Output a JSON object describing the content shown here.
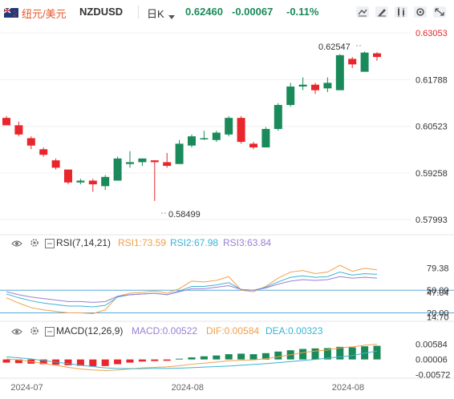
{
  "header": {
    "pair_name": "纽元/美元",
    "symbol": "NZDUSD",
    "timeframe": "日K",
    "price": "0.62460",
    "change": "-0.00067",
    "change_pct": "-0.11%"
  },
  "colors": {
    "up": "#1a8a5a",
    "down": "#e8262b",
    "rsi1": "#f0a04b",
    "rsi2": "#3ab4d4",
    "rsi3": "#9b7fd4",
    "dif": "#f0a04b",
    "dea": "#3ab4d4",
    "hline": "#5aa9d6"
  },
  "icons": [
    "flag-icon",
    "chevron-down-icon",
    "chart-style-icon",
    "drawing-icon",
    "indicator-icon",
    "settings-icon",
    "eye-icon",
    "gear-icon",
    "expand-icon"
  ],
  "rsi": {
    "label": "RSI(7,14,21)",
    "rsi1": "RSI1:73.59",
    "rsi2": "RSI2:67.98",
    "rsi3": "RSI3:63.84"
  },
  "macd": {
    "label": "MACD(12,26,9)",
    "macd": "MACD:0.00522",
    "dif": "DIF:0.00584",
    "dea": "DEA:0.00323"
  },
  "chart_data": {
    "type": "candlestick",
    "price_axis": [
      "0.63053",
      "0.61788",
      "0.60523",
      "0.59258",
      "0.57993"
    ],
    "price_ylim": [
      0.578,
      0.6312
    ],
    "x_ticks": [
      "2024-07",
      "2024-08",
      "2024-08"
    ],
    "annotations": {
      "high": "0.62547",
      "low": "0.58499"
    },
    "candles": [
      {
        "o": 0.6075,
        "h": 0.608,
        "l": 0.6055,
        "c": 0.6055
      },
      {
        "o": 0.6055,
        "h": 0.6065,
        "l": 0.6025,
        "c": 0.603
      },
      {
        "o": 0.602,
        "h": 0.6025,
        "l": 0.599,
        "c": 0.6
      },
      {
        "o": 0.599,
        "h": 0.5995,
        "l": 0.597,
        "c": 0.5975
      },
      {
        "o": 0.596,
        "h": 0.5965,
        "l": 0.5935,
        "c": 0.594
      },
      {
        "o": 0.5935,
        "h": 0.5935,
        "l": 0.5895,
        "c": 0.59
      },
      {
        "o": 0.59,
        "h": 0.591,
        "l": 0.5895,
        "c": 0.5905
      },
      {
        "o": 0.5905,
        "h": 0.591,
        "l": 0.5875,
        "c": 0.5895
      },
      {
        "o": 0.589,
        "h": 0.592,
        "l": 0.588,
        "c": 0.5915
      },
      {
        "o": 0.5905,
        "h": 0.597,
        "l": 0.5905,
        "c": 0.5965
      },
      {
        "o": 0.595,
        "h": 0.5985,
        "l": 0.594,
        "c": 0.5955
      },
      {
        "o": 0.5955,
        "h": 0.5965,
        "l": 0.5945,
        "c": 0.5965
      },
      {
        "o": 0.596,
        "h": 0.596,
        "l": 0.585,
        "c": 0.5955
      },
      {
        "o": 0.5955,
        "h": 0.598,
        "l": 0.594,
        "c": 0.5945
      },
      {
        "o": 0.595,
        "h": 0.6015,
        "l": 0.595,
        "c": 0.6005
      },
      {
        "o": 0.6,
        "h": 0.603,
        "l": 0.5995,
        "c": 0.6025
      },
      {
        "o": 0.602,
        "h": 0.604,
        "l": 0.6015,
        "c": 0.602
      },
      {
        "o": 0.6015,
        "h": 0.604,
        "l": 0.601,
        "c": 0.6035
      },
      {
        "o": 0.603,
        "h": 0.608,
        "l": 0.6025,
        "c": 0.6075
      },
      {
        "o": 0.6075,
        "h": 0.608,
        "l": 0.6005,
        "c": 0.601
      },
      {
        "o": 0.6005,
        "h": 0.601,
        "l": 0.599,
        "c": 0.5995
      },
      {
        "o": 0.5995,
        "h": 0.605,
        "l": 0.5995,
        "c": 0.6045
      },
      {
        "o": 0.6045,
        "h": 0.6115,
        "l": 0.604,
        "c": 0.611
      },
      {
        "o": 0.611,
        "h": 0.617,
        "l": 0.6105,
        "c": 0.616
      },
      {
        "o": 0.616,
        "h": 0.6185,
        "l": 0.615,
        "c": 0.6165
      },
      {
        "o": 0.6165,
        "h": 0.617,
        "l": 0.614,
        "c": 0.615
      },
      {
        "o": 0.6155,
        "h": 0.6185,
        "l": 0.6145,
        "c": 0.617
      },
      {
        "o": 0.615,
        "h": 0.6248,
        "l": 0.615,
        "c": 0.6245
      },
      {
        "o": 0.6235,
        "h": 0.624,
        "l": 0.621,
        "c": 0.622
      },
      {
        "o": 0.62,
        "h": 0.6255,
        "l": 0.62,
        "c": 0.6252
      },
      {
        "o": 0.625,
        "h": 0.6253,
        "l": 0.623,
        "c": 0.624
      }
    ],
    "rsi_axis": [
      "79.38",
      "50.00",
      "47.04",
      "20.00",
      "14.70"
    ],
    "rsi_ylim": [
      10,
      100
    ],
    "rsi1": [
      40,
      33,
      27,
      24,
      22,
      20,
      20,
      19,
      24,
      42,
      46,
      47,
      49,
      46,
      52,
      62,
      61,
      63,
      68,
      50,
      48,
      55,
      66,
      74,
      76,
      72,
      74,
      83,
      75,
      79,
      77
    ],
    "rsi2": [
      45,
      40,
      36,
      33,
      31,
      29,
      29,
      28,
      30,
      41,
      44,
      45,
      46,
      44,
      49,
      55,
      55,
      57,
      60,
      51,
      50,
      54,
      61,
      67,
      69,
      67,
      68,
      74,
      70,
      72,
      71
    ],
    "rsi3": [
      48,
      44,
      41,
      39,
      37,
      35,
      35,
      34,
      35,
      42,
      44,
      45,
      46,
      44,
      48,
      52,
      52,
      54,
      56,
      51,
      50,
      53,
      58,
      62,
      64,
      63,
      64,
      68,
      66,
      67,
      66
    ],
    "rsi_hlines": [
      50,
      20
    ],
    "macd_axis": [
      "0.00584",
      "0.00006",
      "-0.00572"
    ],
    "macd_ylim": [
      -0.0065,
      0.0072
    ],
    "macd_hist": [
      -0.0012,
      -0.0014,
      -0.0016,
      -0.0018,
      -0.002,
      -0.0022,
      -0.0024,
      -0.0026,
      -0.0025,
      -0.0018,
      -0.0012,
      -0.0008,
      -0.0006,
      -0.0005,
      0.0003,
      0.0008,
      0.0012,
      0.0015,
      0.002,
      0.0022,
      0.002,
      0.0024,
      0.003,
      0.0035,
      0.004,
      0.0042,
      0.0043,
      0.0048,
      0.0046,
      0.005,
      0.0052
    ],
    "dif": [
      0.0002,
      -0.0002,
      -0.0008,
      -0.0015,
      -0.0022,
      -0.003,
      -0.0036,
      -0.004,
      -0.0042,
      -0.004,
      -0.0036,
      -0.0032,
      -0.003,
      -0.0028,
      -0.0024,
      -0.0018,
      -0.0014,
      -0.001,
      -0.0005,
      -0.0003,
      -0.0002,
      0.0003,
      0.001,
      0.0018,
      0.0026,
      0.0032,
      0.0036,
      0.0044,
      0.0048,
      0.0054,
      0.0058
    ],
    "dea": [
      0.001,
      0.0006,
      0.0002,
      -0.0004,
      -0.001,
      -0.0016,
      -0.0022,
      -0.0027,
      -0.0032,
      -0.0034,
      -0.0035,
      -0.0035,
      -0.0034,
      -0.0034,
      -0.0033,
      -0.0031,
      -0.0029,
      -0.0027,
      -0.0025,
      -0.0022,
      -0.0019,
      -0.0016,
      -0.0012,
      -0.0008,
      -0.0004,
      0.0,
      0.0005,
      0.001,
      0.0015,
      0.0024,
      0.0032
    ]
  }
}
